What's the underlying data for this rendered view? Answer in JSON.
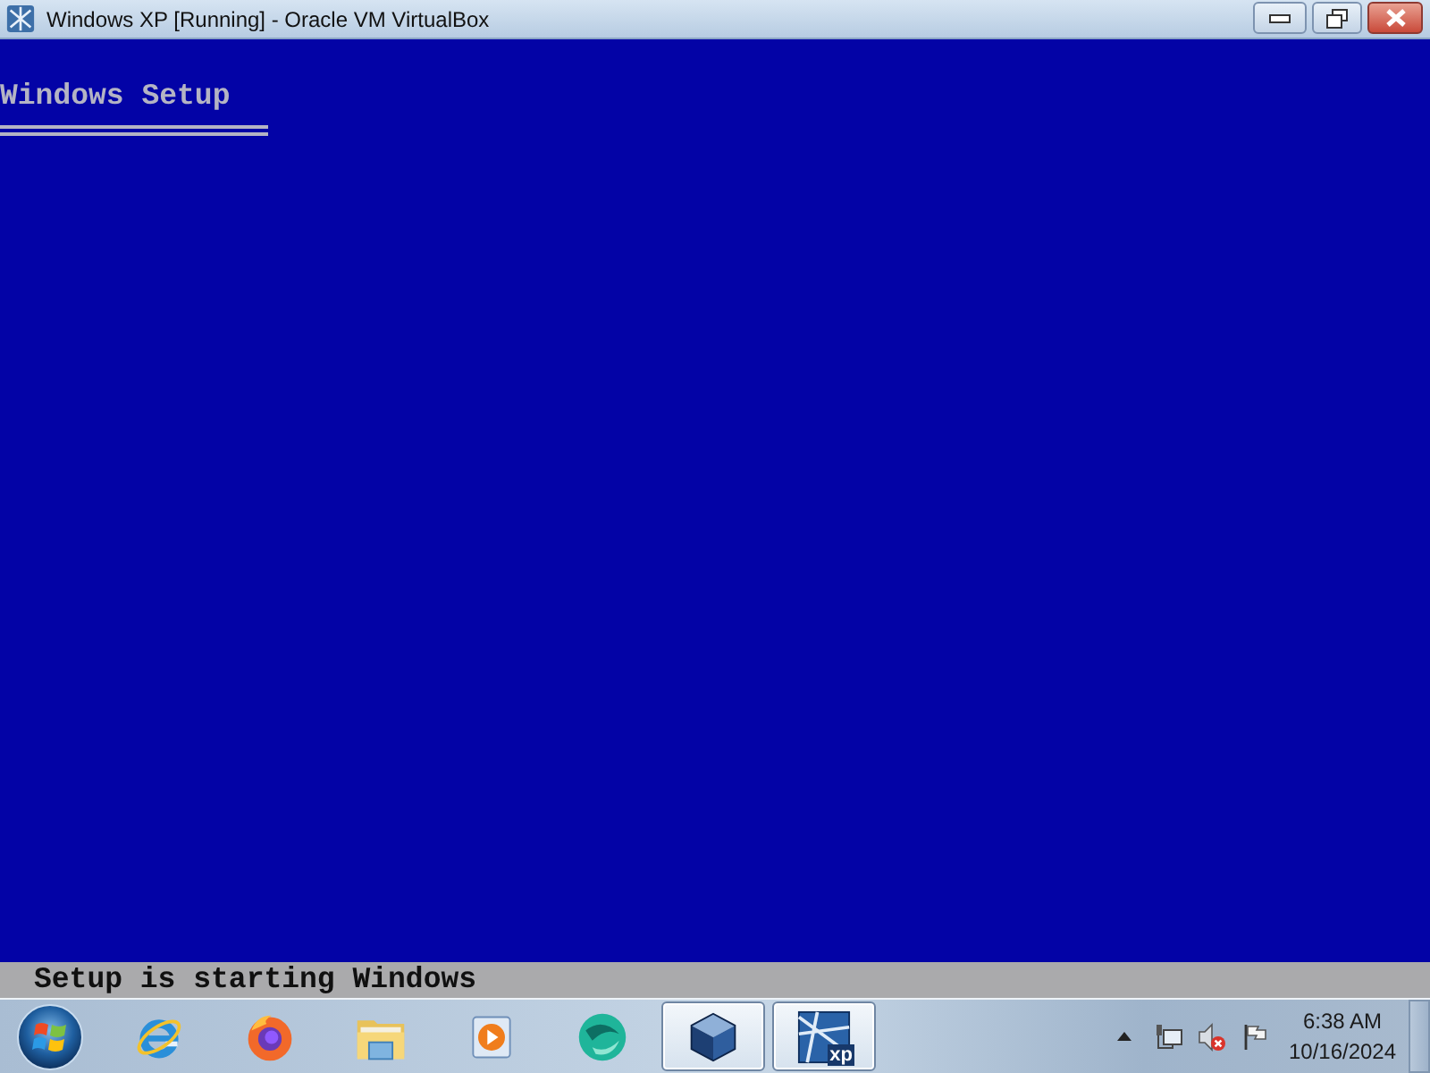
{
  "window": {
    "title": "Windows XP [Running] - Oracle VM VirtualBox"
  },
  "vm_screen": {
    "heading": "Windows Setup",
    "status": "Setup is starting Windows"
  },
  "taskbar": {
    "items": [
      {
        "kind": "ie",
        "running": false
      },
      {
        "kind": "firefox",
        "running": false
      },
      {
        "kind": "folder",
        "running": false
      },
      {
        "kind": "player",
        "running": false
      },
      {
        "kind": "sphere",
        "running": false
      },
      {
        "kind": "cube",
        "running": true
      },
      {
        "kind": "vm",
        "running": true,
        "badge": "xp"
      }
    ],
    "tray": {
      "volume_muted": true,
      "time": "6:38 AM",
      "date": "10/16/2024"
    }
  }
}
